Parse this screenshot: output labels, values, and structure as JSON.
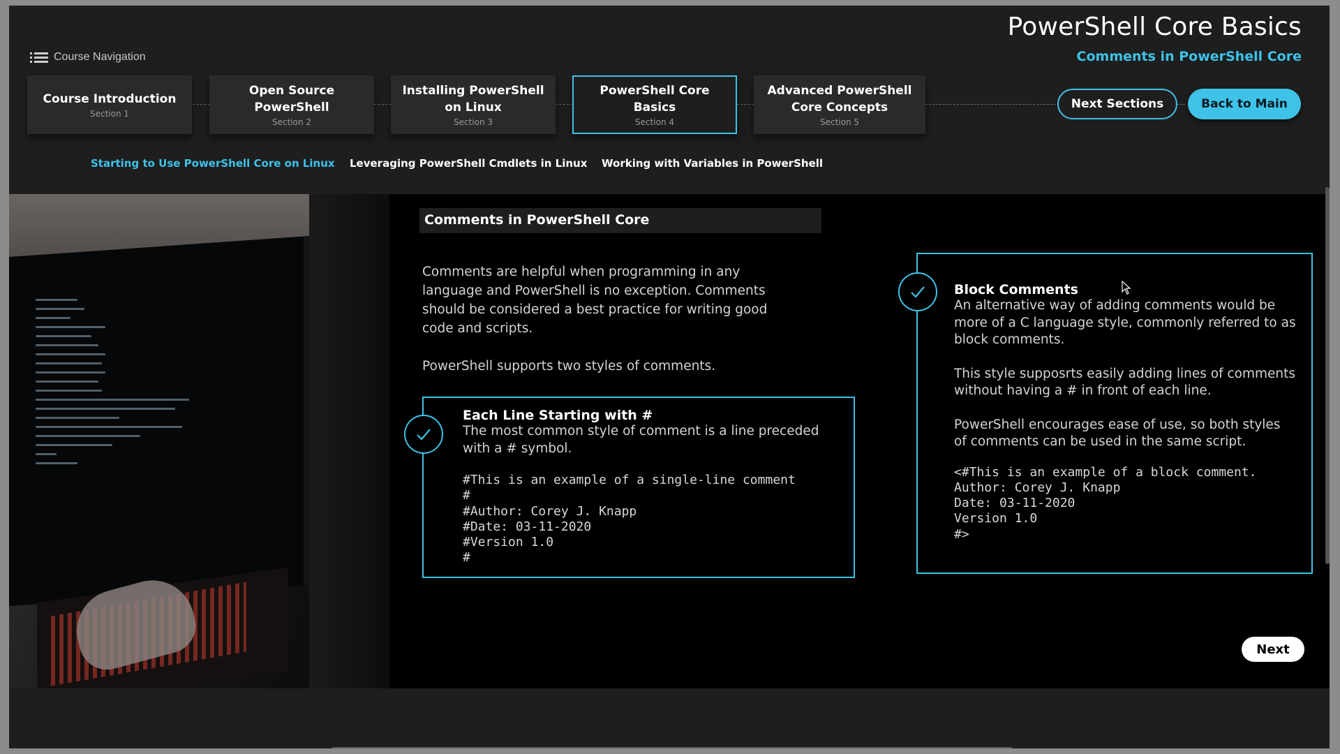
{
  "header": {
    "nav_label": "Course Navigation",
    "title": "PowerShell Core Basics",
    "subtitle": "Comments in PowerShell Core"
  },
  "sections": [
    {
      "title": "Course Introduction",
      "num": "Section 1"
    },
    {
      "title": "Open Source PowerShell",
      "num": "Section 2"
    },
    {
      "title": "Installing PowerShell on Linux",
      "num": "Section 3"
    },
    {
      "title": "PowerShell Core Basics",
      "num": "Section 4"
    },
    {
      "title": "Advanced PowerShell Core Concepts",
      "num": "Section 5"
    }
  ],
  "buttons": {
    "next_sections": "Next Sections",
    "back_to_main": "Back to Main",
    "next": "Next"
  },
  "subtopics": [
    "Starting to Use PowerShell Core on Linux",
    "Leveraging PowerShell Cmdlets in Linux",
    "Working with Variables in PowerShell"
  ],
  "content": {
    "heading": "Comments in PowerShell Core",
    "intro_p1": "Comments are helpful when programming in any language and PowerShell is no exception. Comments should be considered a best practice for writing good code and scripts.",
    "intro_p2": "PowerShell supports two styles of comments.",
    "line_box": {
      "title": "Each Line Starting with #",
      "text": "The most common style of comment is a line preceded with a # symbol.",
      "code": "#This is an example of a single-line comment\n#\n#Author: Corey J. Knapp\n#Date: 03-11-2020\n#Version 1.0\n#"
    },
    "block_box": {
      "title": "Block Comments",
      "text1": "An alternative way of adding comments would be more of a C language style, commonly referred to as block comments.",
      "text2": "This style supposrts easily adding lines of comments without having a # in front of each line.",
      "text3": "PowerShell encourages ease of use, so both styles of comments can be used in the same script.",
      "code": "<#This is an example of a block comment.\nAuthor: Corey J. Knapp\nDate: 03-11-2020\nVersion 1.0\n#>"
    }
  },
  "colors": {
    "accent": "#3ec2e8",
    "background": "#1e1e1e",
    "content_bg": "#000000"
  }
}
